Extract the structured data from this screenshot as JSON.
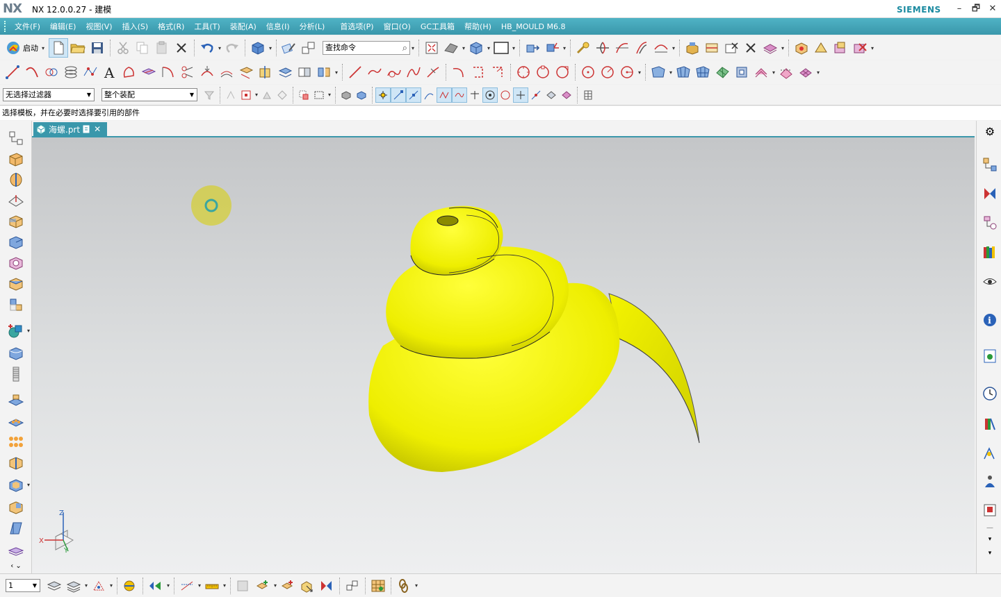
{
  "window": {
    "logo": "NX",
    "title": "NX 12.0.0.27 - 建模",
    "brand": "SIEMENS",
    "controls": {
      "minimize": "–",
      "restore": "🗗",
      "close": "✕"
    }
  },
  "menubar": {
    "items": [
      "文件(F)",
      "编辑(E)",
      "视图(V)",
      "插入(S)",
      "格式(R)",
      "工具(T)",
      "装配(A)",
      "信息(I)",
      "分析(L)",
      "首选项(P)",
      "窗口(O)",
      "GC工具箱",
      "帮助(H)",
      "HB_MOULD M6.8"
    ]
  },
  "toolbar": {
    "start_label": "启动",
    "command_finder_value": "查找命令"
  },
  "selection_bar": {
    "type_filter": "无选择过滤器",
    "scope": "整个装配"
  },
  "cue_line": "选择模板，并在必要时选择要引用的部件",
  "document_tab": {
    "label": "海螺.prt",
    "close": "✕"
  },
  "viewport": {
    "model_color": "#f2f200",
    "background_top": "#c4c6c8",
    "background_bottom": "#eeeff0",
    "triad": {
      "x": "X",
      "y": "Y",
      "z": "Z"
    }
  },
  "bottom_toolbar": {
    "layer_value": "1"
  },
  "colors": {
    "accent": "#3a97ab",
    "menu_text": "#ffffff"
  }
}
